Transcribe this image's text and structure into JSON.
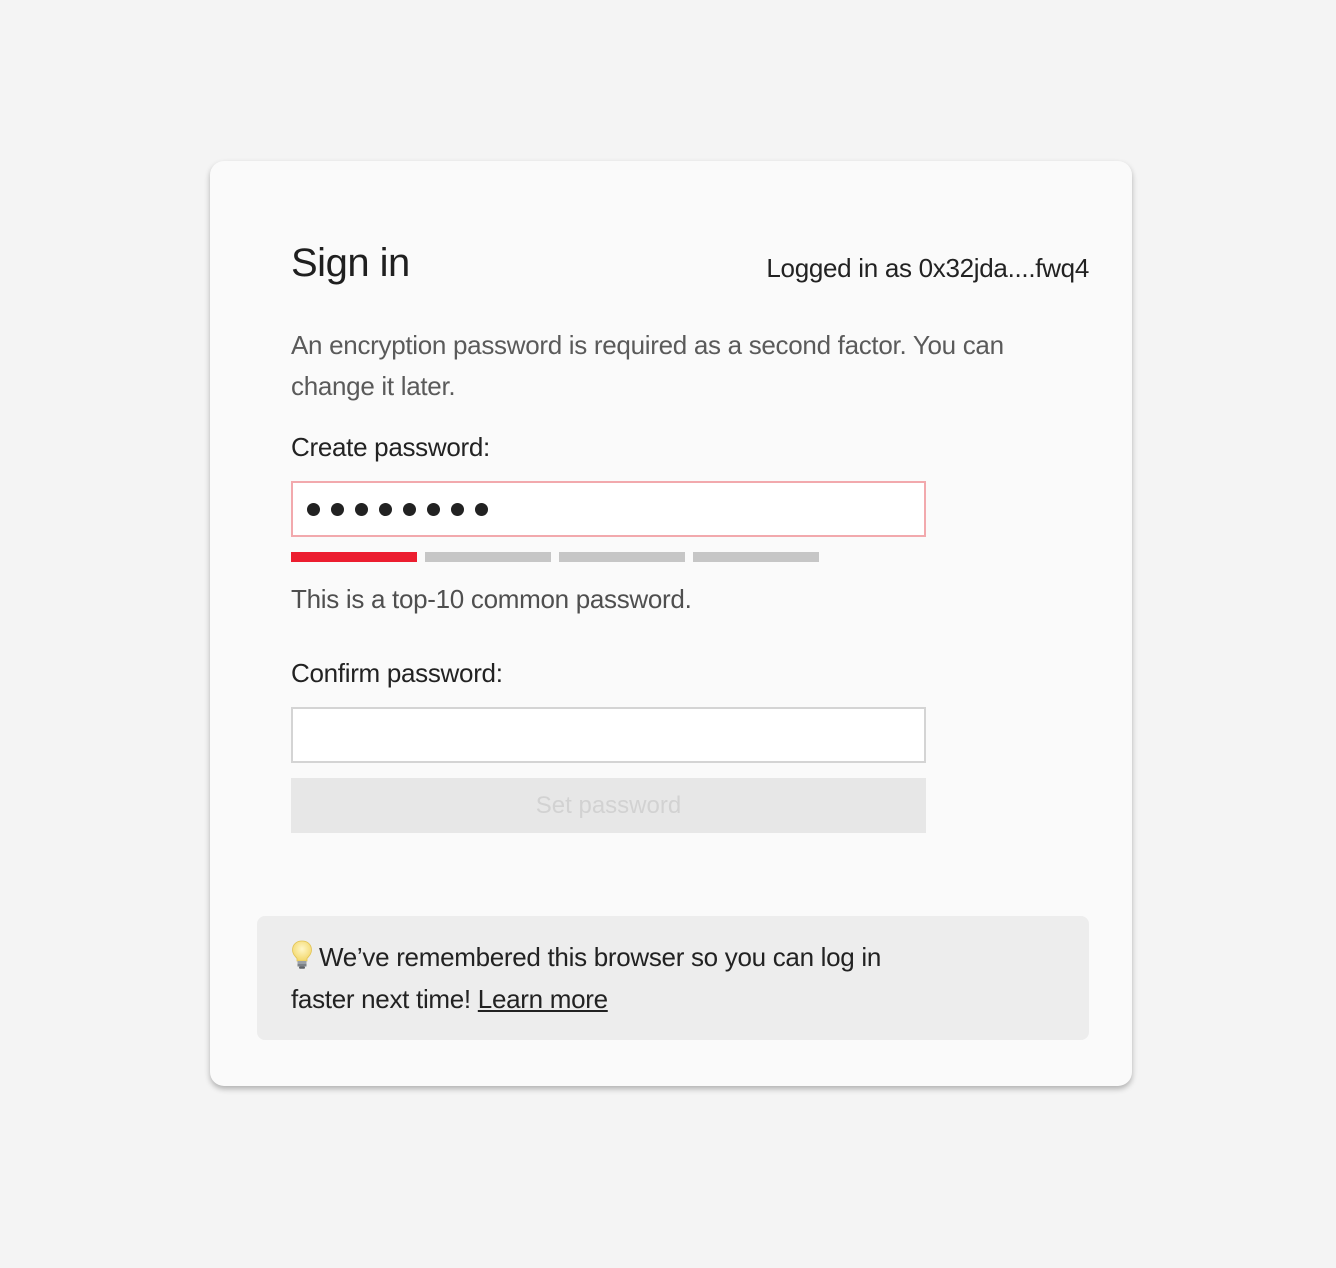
{
  "card": {
    "title": "Sign in",
    "logged_in_as": "Logged in as 0x32jda....fwq4",
    "description": "An encryption password is required as a second factor. You can change it later."
  },
  "create_password": {
    "label": "Create password:",
    "masked_length": 8,
    "border_color": "#f2a9ad"
  },
  "strength": {
    "segments_total": 4,
    "segments_filled": 1,
    "active_color": "#ec1d2f",
    "inactive_color": "#c6c6c6",
    "message": "This is a top-10 common password."
  },
  "confirm_password": {
    "label": "Confirm password:",
    "value": ""
  },
  "submit": {
    "label": "Set password",
    "disabled": true
  },
  "notice": {
    "icon": "lightbulb-icon",
    "text": "We’ve remembered this browser so you can log in faster next time!",
    "link_label": "Learn more"
  }
}
